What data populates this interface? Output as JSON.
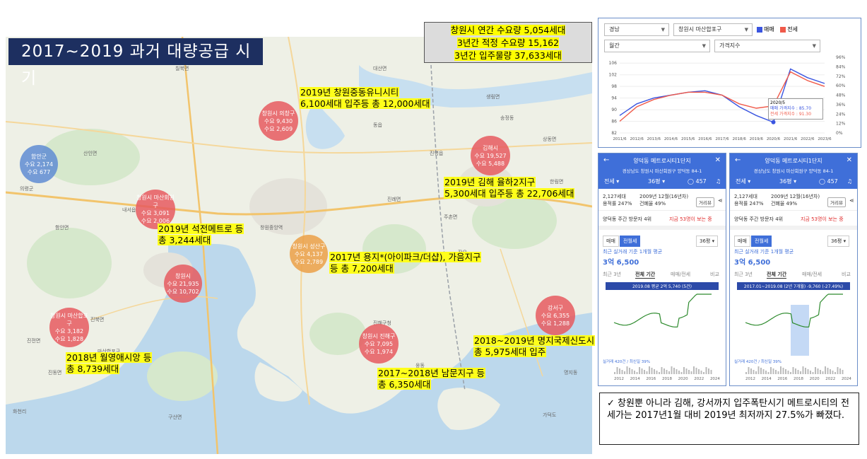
{
  "banner": {
    "title": "2017~2019 과거 대량공급 시기"
  },
  "summary": {
    "line1": "창원시 연간 수요량 5,054세대",
    "line2": "3년간 적정 수요량 15,162",
    "line3": "3년간 입주물량 37,633세대"
  },
  "callouts": [
    {
      "l1": "2019년 창원중동유니시티",
      "l2": "6,100세대 입주등 총 12,000세대"
    },
    {
      "l1": "2019년 김해 율하2지구",
      "l2": "5,300세대 입주등 총 22,706세대"
    },
    {
      "l1": "2019년 석전메트로 등",
      "l2": "총 3,244세대"
    },
    {
      "l1": "2017년 용지*(아이파크/더샵), 가음지구",
      "l2": "등 총 7,200세대"
    },
    {
      "l1": "2018~2019년 명지국제신도시",
      "l2": "총 5,975세대 입주"
    },
    {
      "l1": "2018년 월영애시앙 등",
      "l2": "총 8,739세대"
    },
    {
      "l1": "2017~2018년 남문지구 등",
      "l2": "총 6,350세대"
    }
  ],
  "circles": [
    {
      "name": "창원시 의창구",
      "a": "수요 9,430",
      "b": "수요 2,609"
    },
    {
      "name": "김해시",
      "a": "수요 19,527",
      "b": "수요 5,488"
    },
    {
      "name": "함안군",
      "a": "수요 2,174",
      "b": "수요 677"
    },
    {
      "name": "창원시 마산회원구",
      "a": "수요 3,091",
      "b": "수요 2,006"
    },
    {
      "name": "창원시 성산구",
      "a": "수요 4,137",
      "b": "수요 2,789"
    },
    {
      "name": "창원시",
      "a": "수요 21,935",
      "b": "수요 10,702"
    },
    {
      "name": "창원시 마산합포구",
      "a": "수요 3,182",
      "b": "수요 1,828"
    },
    {
      "name": "창원시 진해구",
      "a": "수요 7,095",
      "b": "수요 1,974"
    },
    {
      "name": "강서구",
      "a": "수요 6,355",
      "b": "수요 1,288"
    }
  ],
  "map_labels": [
    "칠북면",
    "대산면",
    "산인면",
    "함안면",
    "의령군",
    "진전면",
    "진북면",
    "구산면",
    "화천리",
    "창원중앙역",
    "진해구청",
    "동읍",
    "진례면",
    "장유",
    "주촌면",
    "가덕도",
    "마산합포구",
    "내서읍",
    "진동면",
    "송정동",
    "상동면",
    "진영읍",
    "생림면",
    "한림면",
    "웅동",
    "명지동"
  ],
  "chart_panel": {
    "region": "경남",
    "district": "창원시 마산합포구",
    "legend_sale": "매매",
    "legend_rent": "전세",
    "period": "월간",
    "metric": "가격지수",
    "tooltip_date": "2020/5",
    "tooltip_sale": "매매 가격지수 : 85.70",
    "tooltip_rent": "전세 가격지수 : 91.30",
    "colors": {
      "sale": "#3a55e0",
      "rent": "#f05a4a"
    }
  },
  "chart_data": {
    "type": "line",
    "x": [
      "2011/6",
      "2012/6",
      "2013/6",
      "2014/6",
      "2015/6",
      "2016/6",
      "2017/6",
      "2018/6",
      "2019/6",
      "2020/6",
      "2021/6",
      "2022/6",
      "2023/6"
    ],
    "ylim": [
      82,
      108
    ],
    "y2_ticks": [
      "0%",
      "12%",
      "24%",
      "36%",
      "48%",
      "60%",
      "72%",
      "84%",
      "96%"
    ],
    "y_ticks": [
      "82",
      "86",
      "90",
      "94",
      "98",
      "102",
      "106"
    ],
    "series": [
      {
        "name": "매매",
        "values": [
          88,
          92,
          94,
          95,
          96,
          96.5,
          95,
          91,
          88,
          85.7,
          104,
          101,
          99
        ]
      },
      {
        "name": "전세",
        "values": [
          86,
          91,
          93.5,
          95,
          96,
          96,
          95,
          92,
          90.5,
          91.3,
          103,
          100,
          98
        ]
      }
    ]
  },
  "apt_panels": [
    {
      "title": "양덕동 메트로시티1단지",
      "addr": "경상남도 창원시 마산회원구 양덕동 84-1",
      "mode": "전세",
      "size": "36평",
      "comments": "457",
      "units": "2,127세대",
      "far": "용적률 247%",
      "built": "2009년 12월(16년차)",
      "bcr": "건폐율 49%",
      "dist": "거리뷰",
      "rank": "양덕동 주간 방문자 4위",
      "rank_link": "지금 53명이 보는 중",
      "tab_a": "매매",
      "tab_b": "전월세",
      "size2": "36평",
      "avg_label": "최근 실거래 기준 1개월 평균",
      "price": "3억 6,500",
      "periods": [
        "최근 3년",
        "전체 기간",
        "매매/전세",
        "비교"
      ],
      "tooltip": "2019.08 평균 2억 5,740 (5건)",
      "years": [
        "2012",
        "2014",
        "2016",
        "2018",
        "2020",
        "2022",
        "2024"
      ],
      "footer": "실거래 420건 / 최신일 39%"
    },
    {
      "title": "양덕동 메트로시티1단지",
      "addr": "경상남도 창원시 마산회원구 양덕동 84-1",
      "mode": "전세",
      "size": "36평",
      "comments": "457",
      "units": "2,127세대",
      "far": "용적률 247%",
      "built": "2009년 12월(16년차)",
      "bcr": "건폐율 49%",
      "dist": "거리뷰",
      "rank": "양덕동 주간 방문자 4위",
      "rank_link": "지금 53명이 보는 중",
      "tab_a": "매매",
      "tab_b": "전월세",
      "size2": "36평",
      "avg_label": "최근 실거래 기준 1개월 평균",
      "price": "3억 6,500",
      "periods": [
        "최근 3년",
        "전체 기간",
        "매매/전세",
        "비교"
      ],
      "tooltip": "2017.01~2019.08 (2년 7개월) -9,760 (-27.49%)",
      "years": [
        "2012",
        "2014",
        "2016",
        "2018",
        "2020",
        "2022",
        "2024"
      ],
      "footer": "실거래 420건 / 최신일 39%"
    }
  ],
  "note": {
    "check": "✓",
    "text": "창원뿐 아니라 김해, 강서까지 입주폭탄시기 메트로시티의 전세가는 2017년1월 대비 2019년 최저까지 27.5%가 빠졌다."
  }
}
